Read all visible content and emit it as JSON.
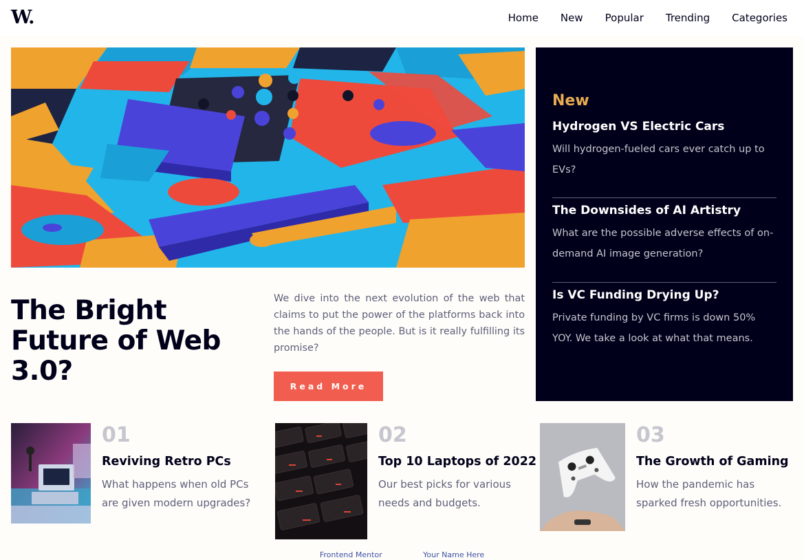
{
  "nav": {
    "logo": "W.",
    "links": [
      "Home",
      "New",
      "Popular",
      "Trending",
      "Categories"
    ]
  },
  "hero": {
    "title": "The Bright Future of Web 3.0?",
    "description": "We dive into the next evolution of the web that claims to put the power of the platforms back into the hands of the people. But is it really fulfilling its promise?",
    "button_label": "Read More"
  },
  "sidebar": {
    "heading": "New",
    "items": [
      {
        "title": "Hydrogen VS Electric Cars",
        "text": "Will hydrogen-fueled cars ever catch up to EVs?"
      },
      {
        "title": "The Downsides of AI Artistry",
        "text": "What are the possible adverse effects of on-demand AI image generation?"
      },
      {
        "title": "Is VC Funding Drying Up?",
        "text": "Private funding by VC firms is down 50% YOY. We take a look at what that means."
      }
    ]
  },
  "cards": [
    {
      "num": "01",
      "title": "Reviving Retro PCs",
      "desc": "What happens when old PCs are given modern upgrades?"
    },
    {
      "num": "02",
      "title": "Top 10 Laptops of 2022",
      "desc": "Our best picks for various needs and budgets."
    },
    {
      "num": "03",
      "title": "The Growth of Gaming",
      "desc": "How the pandemic has sparked fresh opportunities."
    }
  ],
  "attribution": {
    "left": "Frontend Mentor",
    "right": "Your Name Here"
  },
  "colors": {
    "accent_orange": "#e9ab53",
    "button_red": "#f15e50",
    "dark_navy": "#00001a",
    "muted_text": "#5d5f79"
  }
}
